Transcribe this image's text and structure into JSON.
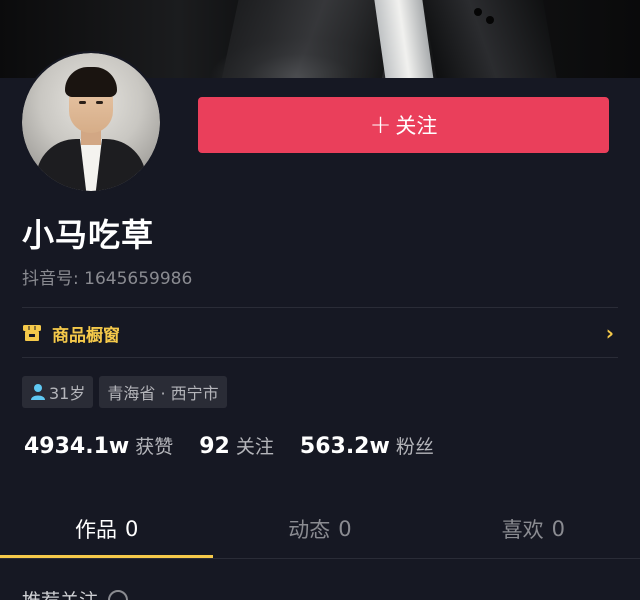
{
  "profile": {
    "follow_plus": "+",
    "follow_label": "关注",
    "nickname": "小马吃草",
    "douyin_id": "抖音号: 1645659986"
  },
  "shop": {
    "label": "商品橱窗",
    "icon": "storefront-icon",
    "chevron": "›"
  },
  "tags": {
    "age": "31岁",
    "location": "青海省 · 西宁市"
  },
  "stats": [
    {
      "value": "4934.1w",
      "label": "获赞"
    },
    {
      "value": "92",
      "label": "关注"
    },
    {
      "value": "563.2w",
      "label": "粉丝"
    }
  ],
  "tabs": [
    {
      "label": "作品",
      "count": "0",
      "active": true
    },
    {
      "label": "动态",
      "count": "0",
      "active": false
    },
    {
      "label": "喜欢",
      "count": "0",
      "active": false
    }
  ],
  "recommend": {
    "label": "推荐关注"
  },
  "colors": {
    "background": "#161823",
    "follow_button": "#ea3f5b",
    "shop_accent": "#f5c94a",
    "tab_indicator": "#f5c94a",
    "person_icon": "#5fc9f3"
  }
}
